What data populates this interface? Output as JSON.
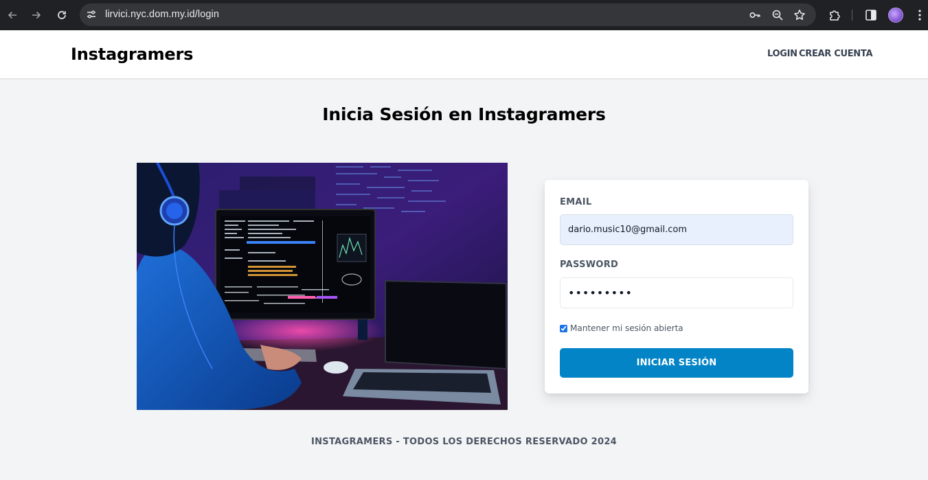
{
  "browser": {
    "url": "lirvici.nyc.dom.my.id/login"
  },
  "header": {
    "brand": "Instagramers",
    "nav": {
      "login": "LOGIN",
      "register": "CREAR CUENTA"
    }
  },
  "main": {
    "title": "Inicia Sesión en Instagramers"
  },
  "form": {
    "email_label": "EMAIL",
    "email_value": "dario.music10@gmail.com",
    "password_label": "PASSWORD",
    "password_value": "•••••••••",
    "remember_label": "Mantener mi sesión abierta",
    "remember_checked": true,
    "submit_label": "INICIAR SESIÓN"
  },
  "footer": {
    "text": "INSTAGRAMERS - TODOS LOS DERECHOS RESERVADO 2024"
  },
  "colors": {
    "primary_button": "#0284c7",
    "page_background": "#f3f4f6",
    "autofill_background": "#e8f0fe"
  },
  "icons": {
    "back": "arrow-left-icon",
    "forward": "arrow-right-icon",
    "reload": "reload-icon",
    "site_info": "tune-icon",
    "password_manager": "key-icon",
    "zoom": "zoom-icon",
    "bookmark": "star-icon",
    "extensions": "puzzle-icon",
    "side_panel": "side-panel-icon",
    "menu": "kebab-menu-icon"
  }
}
